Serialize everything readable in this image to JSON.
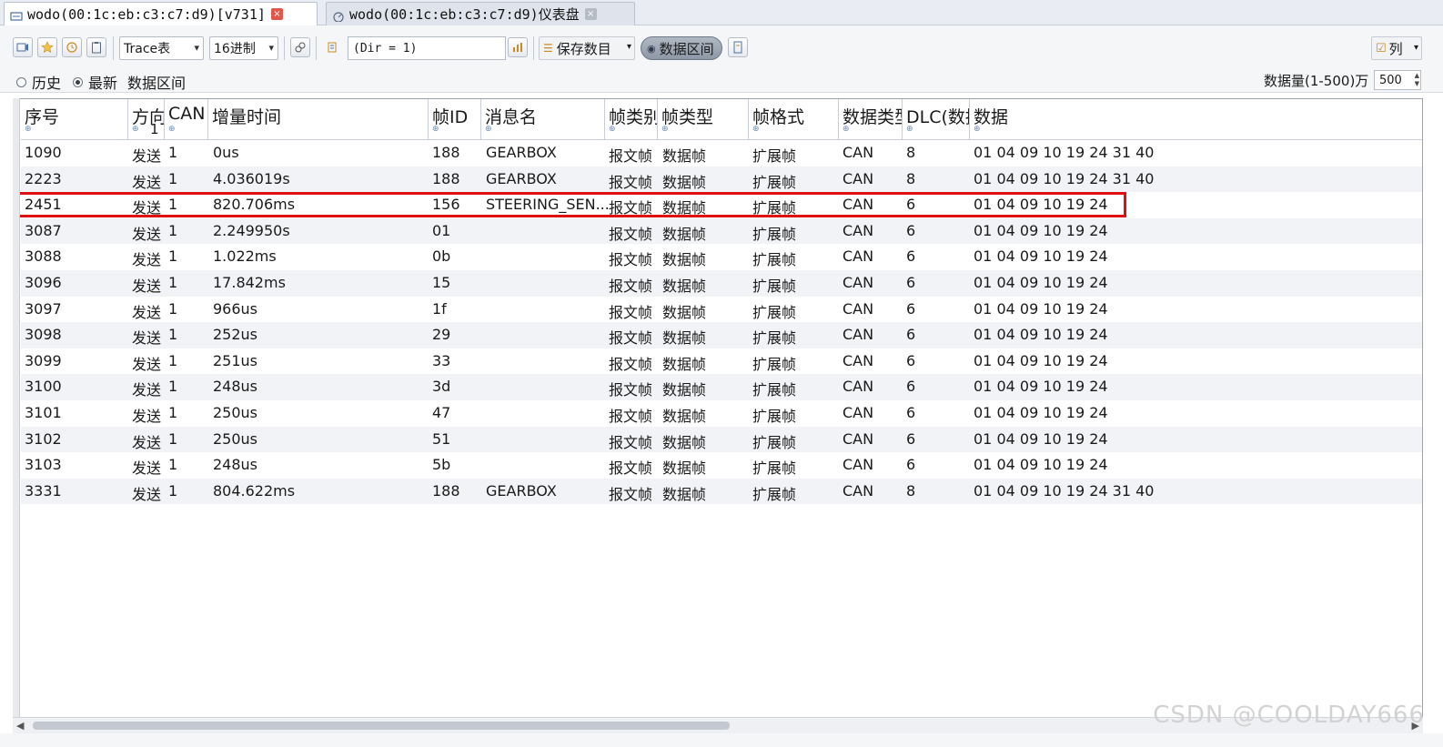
{
  "tabs": [
    {
      "label": "wodo(00:1c:eb:c3:c7:d9)[v731]",
      "close": "×"
    },
    {
      "label": "wodo(00:1c:eb:c3:c7:d9)仪表盘",
      "close": "×"
    }
  ],
  "toolbar": {
    "view_select": "Trace表",
    "radix_select": "16进制",
    "filter_text": "(Dir = 1)",
    "save_label": "保存数目",
    "range_label": "数据区间",
    "columns_label": "列"
  },
  "mode": {
    "history_label": "历史",
    "latest_label": "最新",
    "range_text": "数据区间",
    "count_label": "数据量(1-500)万",
    "count_value": "500"
  },
  "columns": [
    "序号",
    "方向",
    "CAN",
    "增量时间",
    "帧ID",
    "消息名",
    "帧类别",
    "帧类型",
    "帧格式",
    "数据类型",
    "DLC(数据长度)",
    "数据"
  ],
  "sort_indicator": "1",
  "rows": [
    [
      "1090",
      "发送",
      "1",
      "0us",
      "188",
      "GEARBOX",
      "报文帧",
      "数据帧",
      "扩展帧",
      "CAN",
      "8",
      "01 04 09 10 19 24 31 40"
    ],
    [
      "2223",
      "发送",
      "1",
      "4.036019s",
      "188",
      "GEARBOX",
      "报文帧",
      "数据帧",
      "扩展帧",
      "CAN",
      "8",
      "01 04 09 10 19 24 31 40"
    ],
    [
      "2451",
      "发送",
      "1",
      "820.706ms",
      "156",
      "STEERING_SEN...",
      "报文帧",
      "数据帧",
      "扩展帧",
      "CAN",
      "6",
      "01 04 09 10 19 24"
    ],
    [
      "3087",
      "发送",
      "1",
      "2.249950s",
      "01",
      "",
      "报文帧",
      "数据帧",
      "扩展帧",
      "CAN",
      "6",
      "01 04 09 10 19 24"
    ],
    [
      "3088",
      "发送",
      "1",
      "1.022ms",
      "0b",
      "",
      "报文帧",
      "数据帧",
      "扩展帧",
      "CAN",
      "6",
      "01 04 09 10 19 24"
    ],
    [
      "3096",
      "发送",
      "1",
      "17.842ms",
      "15",
      "",
      "报文帧",
      "数据帧",
      "扩展帧",
      "CAN",
      "6",
      "01 04 09 10 19 24"
    ],
    [
      "3097",
      "发送",
      "1",
      "966us",
      "1f",
      "",
      "报文帧",
      "数据帧",
      "扩展帧",
      "CAN",
      "6",
      "01 04 09 10 19 24"
    ],
    [
      "3098",
      "发送",
      "1",
      "252us",
      "29",
      "",
      "报文帧",
      "数据帧",
      "扩展帧",
      "CAN",
      "6",
      "01 04 09 10 19 24"
    ],
    [
      "3099",
      "发送",
      "1",
      "251us",
      "33",
      "",
      "报文帧",
      "数据帧",
      "扩展帧",
      "CAN",
      "6",
      "01 04 09 10 19 24"
    ],
    [
      "3100",
      "发送",
      "1",
      "248us",
      "3d",
      "",
      "报文帧",
      "数据帧",
      "扩展帧",
      "CAN",
      "6",
      "01 04 09 10 19 24"
    ],
    [
      "3101",
      "发送",
      "1",
      "250us",
      "47",
      "",
      "报文帧",
      "数据帧",
      "扩展帧",
      "CAN",
      "6",
      "01 04 09 10 19 24"
    ],
    [
      "3102",
      "发送",
      "1",
      "250us",
      "51",
      "",
      "报文帧",
      "数据帧",
      "扩展帧",
      "CAN",
      "6",
      "01 04 09 10 19 24"
    ],
    [
      "3103",
      "发送",
      "1",
      "248us",
      "5b",
      "",
      "报文帧",
      "数据帧",
      "扩展帧",
      "CAN",
      "6",
      "01 04 09 10 19 24"
    ],
    [
      "3331",
      "发送",
      "1",
      "804.622ms",
      "188",
      "GEARBOX",
      "报文帧",
      "数据帧",
      "扩展帧",
      "CAN",
      "8",
      "01 04 09 10 19 24 31 40"
    ]
  ],
  "highlighted_row": "2451",
  "watermark": "CSDN @COOLDAY666",
  "colors": {
    "highlight_border": "#e01010",
    "accent": "#4a6fa8"
  }
}
